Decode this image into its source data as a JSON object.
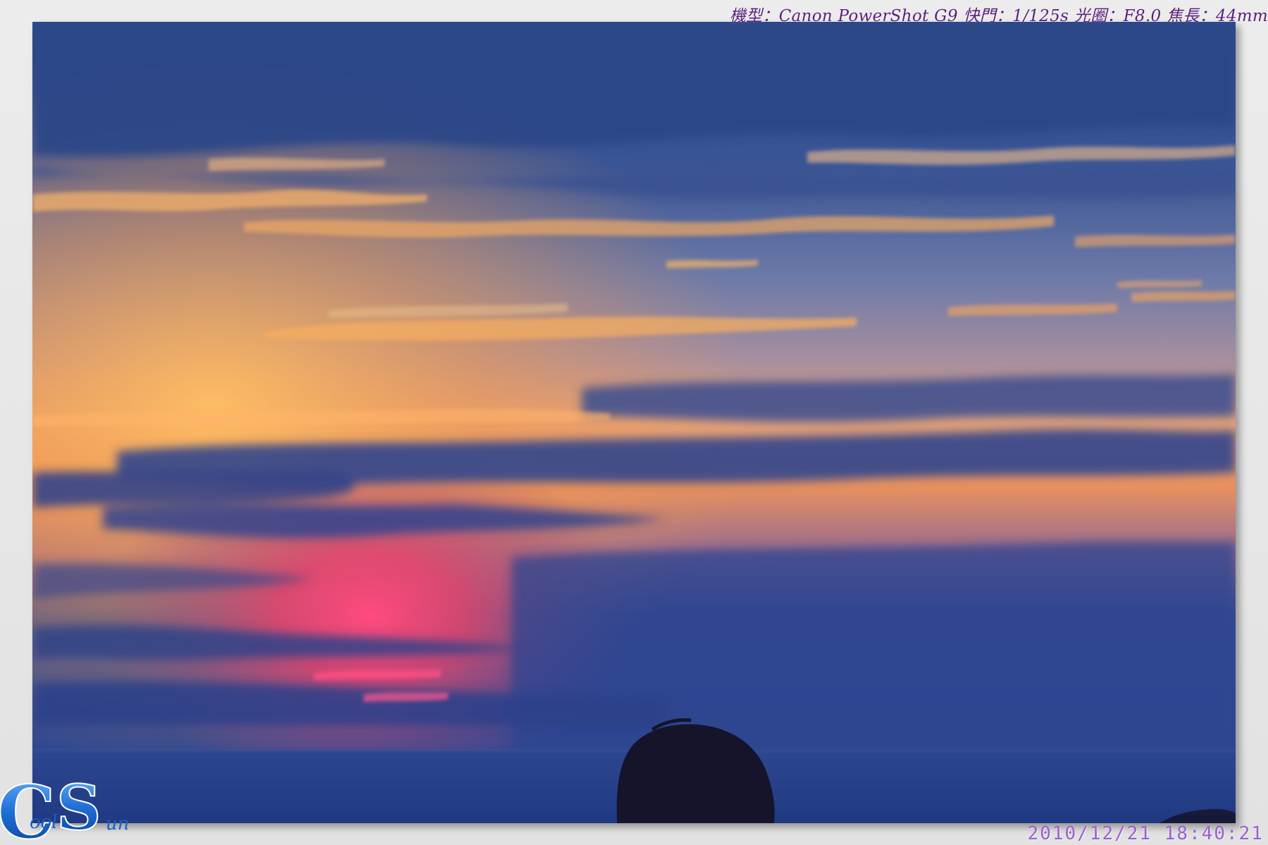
{
  "caption": {
    "exif": "機型：Canon PowerShot G9 快門：1/125s 光圈：F8.0 焦長：44mm"
  },
  "timestamp": "2010/12/21  18:40:21",
  "logo": {
    "letters": "CoolSun",
    "letter_c": "C",
    "letter_s": "S",
    "small_c": "ool",
    "small_s": "un"
  },
  "photo": {
    "subject": "sunset-sky-with-clouds",
    "colors": {
      "sky_top": "#2d4a8c",
      "sky_mid": "#6e7fb0",
      "glow_orange": "#f6a253",
      "glow_pink": "#e8476b",
      "sea": "#24418a",
      "silhouette": "#15142a"
    }
  },
  "colors": {
    "caption": "#5a1f7f",
    "timestamp": "#9b5fd0",
    "logo_blue": "#1e6fd6"
  }
}
